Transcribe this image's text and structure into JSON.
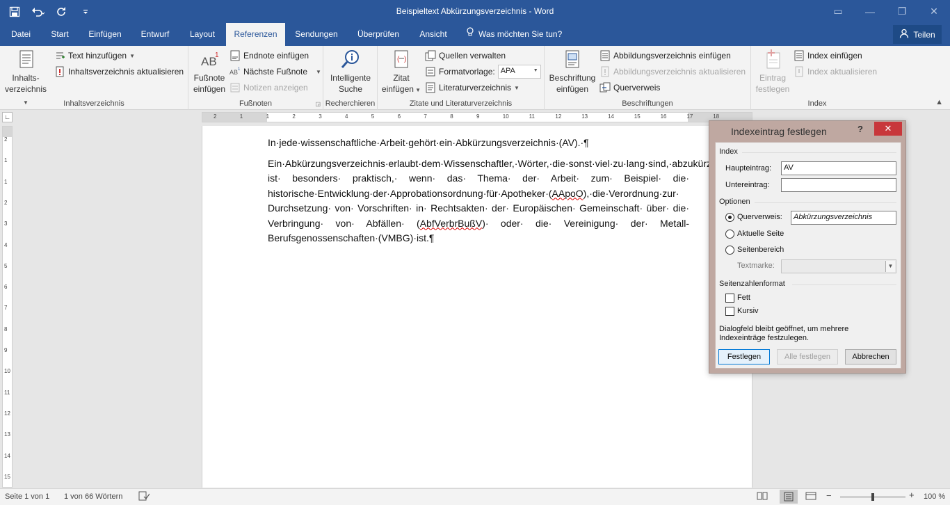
{
  "window": {
    "title": "Beispieltext Abkürzungsverzeichnis  -  Word",
    "share_label": "Teilen",
    "tell_me": "Was möchten Sie tun?"
  },
  "tabs": [
    {
      "label": "Datei"
    },
    {
      "label": "Start"
    },
    {
      "label": "Einfügen"
    },
    {
      "label": "Entwurf"
    },
    {
      "label": "Layout"
    },
    {
      "label": "Referenzen"
    },
    {
      "label": "Sendungen"
    },
    {
      "label": "Überprüfen"
    },
    {
      "label": "Ansicht"
    }
  ],
  "ribbon": {
    "toc": {
      "big_line1": "Inhalts-",
      "big_line2": "verzeichnis",
      "add_text": "Text hinzufügen",
      "update": "Inhaltsverzeichnis aktualisieren",
      "group": "Inhaltsverzeichnis"
    },
    "footnotes": {
      "big_line1": "Fußnote",
      "big_line2": "einfügen",
      "endnote": "Endnote einfügen",
      "next": "Nächste Fußnote",
      "show": "Notizen anzeigen",
      "group": "Fußnoten"
    },
    "research": {
      "big_line1": "Intelligente",
      "big_line2": "Suche",
      "group": "Recherchieren"
    },
    "citations": {
      "big_line1": "Zitat",
      "big_line2": "einfügen",
      "manage": "Quellen verwalten",
      "style_label": "Formatvorlage:",
      "style_value": "APA",
      "bibliography": "Literaturverzeichnis",
      "group": "Zitate und Literaturverzeichnis"
    },
    "captions": {
      "big_line1": "Beschriftung",
      "big_line2": "einfügen",
      "insert_tof": "Abbildungsverzeichnis einfügen",
      "update_tof": "Abbildungsverzeichnis aktualisieren",
      "cross_ref": "Querverweis",
      "group": "Beschriftungen"
    },
    "index": {
      "big_line1": "Eintrag",
      "big_line2": "festlegen",
      "insert": "Index einfügen",
      "update": "Index aktualisieren",
      "group": "Index"
    }
  },
  "ruler": {
    "labels": [
      "2",
      "1",
      "1",
      "2",
      "3",
      "4",
      "5",
      "6",
      "7",
      "8",
      "9",
      "10",
      "11",
      "12",
      "13",
      "14",
      "15",
      "16",
      "17",
      "18"
    ]
  },
  "vruler": {
    "labels": [
      "2",
      "1",
      "1",
      "2",
      "3",
      "4",
      "5",
      "6",
      "7",
      "8",
      "9",
      "10",
      "11",
      "12",
      "13",
      "14",
      "15"
    ]
  },
  "document": {
    "p1": "In·jede·wissenschaftliche·Arbeit·gehört·ein·Abkürzungsverzeichnis·(AV).·¶",
    "p2_a": "Ein·Abkürzungsverzeichnis·erlaubt·dem·Wissenschaftler,·Wörter,·die·sonst·viel·zu·lang·sind,·abzukürzen.·Das· ist· besonders· praktisch,· wenn· das· Thema· der· Arbeit· zum· Beispiel· die· historische·Entwicklung·der·Approbationsordnung·für·Apotheker·(",
    "p2_sq1": "AApoO",
    "p2_b": "),·die·Verordnung·zur· Durchsetzung· von· Vorschriften· in· Rechtsakten· der· Europäischen· Gemeinschaft· über· die· Verbringung· von· Abfällen· (",
    "p2_sq2": "AbfVerbrBußV",
    "p2_c": ")· oder· die· Vereinigung· der· Metall-Berufsgenossenschaften·(VMBG)·ist.¶"
  },
  "status": {
    "page": "Seite 1 von 1",
    "words": "1 von 66 Wörtern",
    "zoom": "100 %",
    "zoom_fraction": 0.5
  },
  "dialog": {
    "title": "Indexeintrag festlegen",
    "help": "?",
    "close": "✕",
    "sec_index": "Index",
    "main_label": "Haupteintrag:",
    "main_value": "AV",
    "sub_label": "Untereintrag:",
    "sub_value": "",
    "sec_options": "Optionen",
    "opt_crossref": "Querverweis:",
    "crossref_value": "Abkürzungsverzeichnis",
    "opt_current": "Aktuelle Seite",
    "opt_range": "Seitenbereich",
    "bookmark_label": "Textmarke:",
    "sec_format": "Seitenzahlenformat",
    "bold": "Fett",
    "italic": "Kursiv",
    "note": "Dialogfeld bleibt geöffnet, um mehrere Indexeinträge festzulegen.",
    "btn_mark": "Festlegen",
    "btn_mark_all": "Alle festlegen",
    "btn_cancel": "Abbrechen"
  }
}
